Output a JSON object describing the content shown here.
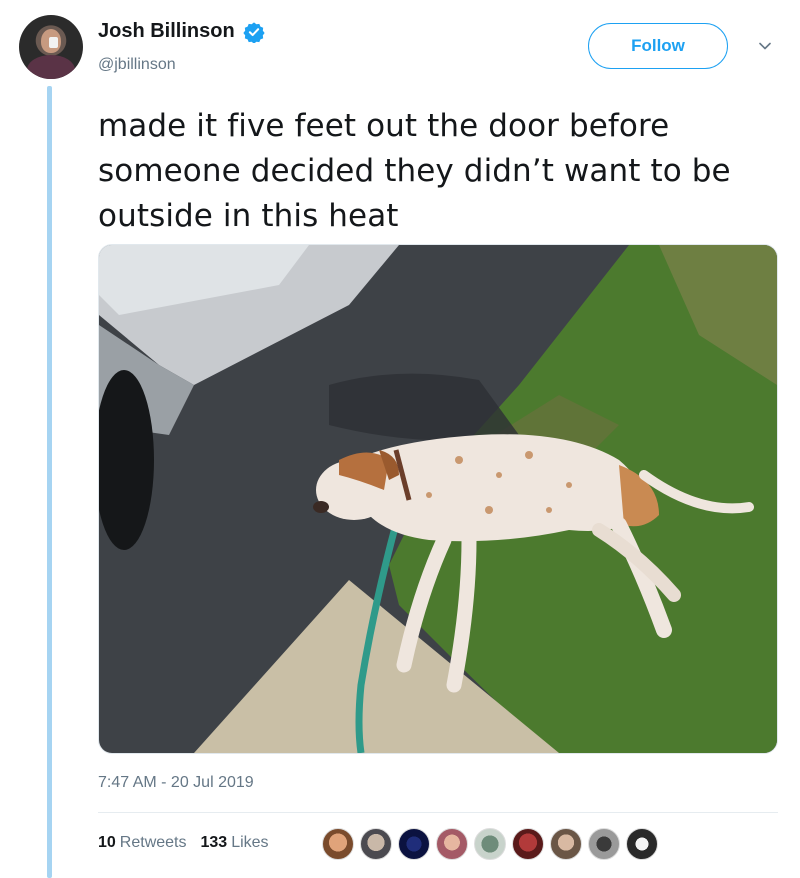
{
  "author": {
    "name": "Josh Billinson",
    "handle": "@jbillinson"
  },
  "actions": {
    "follow_label": "Follow"
  },
  "tweet": {
    "line1": "made it five feet out the door before",
    "line2": "someone decided they didn’t want to be",
    "line3": "outside in this heat",
    "timestamp": "7:47 AM - 20 Jul 2019"
  },
  "stats": {
    "retweets_count": "10",
    "retweets_label": "Retweets",
    "likes_count": "133",
    "likes_label": "Likes"
  },
  "colors": {
    "accent": "#1da1f2",
    "thread_line": "#a6d4f2",
    "muted_text": "#657786"
  },
  "icons": {
    "verified": "verified-badge-icon",
    "more": "chevron-down-icon"
  }
}
